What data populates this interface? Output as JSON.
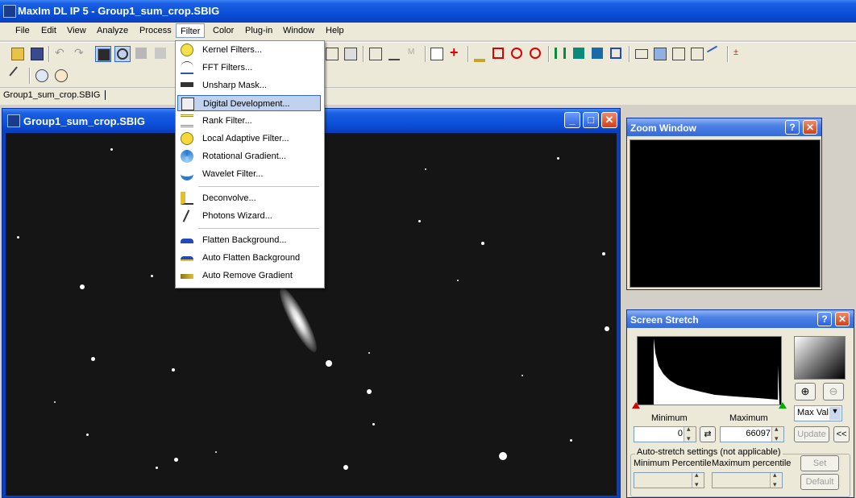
{
  "app": {
    "title": "MaxIm DL IP 5 - Group1_sum_crop.SBIG"
  },
  "menubar": {
    "items": [
      {
        "label": "File"
      },
      {
        "label": "Edit"
      },
      {
        "label": "View"
      },
      {
        "label": "Analyze"
      },
      {
        "label": "Process"
      },
      {
        "label": "Filter"
      },
      {
        "label": "Color"
      },
      {
        "label": "Plug-in"
      },
      {
        "label": "Window"
      },
      {
        "label": "Help"
      }
    ]
  },
  "filter_menu": {
    "items": [
      {
        "label": "Kernel Filters..."
      },
      {
        "label": "FFT Filters..."
      },
      {
        "label": "Unsharp Mask..."
      },
      {
        "label": "Digital Development..."
      },
      {
        "label": "Rank Filter..."
      },
      {
        "label": "Local Adaptive Filter..."
      },
      {
        "label": "Rotational Gradient..."
      },
      {
        "label": "Wavelet Filter..."
      },
      {
        "label": "Deconvolve..."
      },
      {
        "label": "Photons Wizard..."
      },
      {
        "label": "Flatten Background..."
      },
      {
        "label": "Auto Flatten Background"
      },
      {
        "label": "Auto Remove Gradient"
      }
    ],
    "highlighted": "Digital Development..."
  },
  "document_tab": {
    "label": "Group1_sum_crop.SBIG"
  },
  "image_window": {
    "title": "Group1_sum_crop.SBIG"
  },
  "zoom_window": {
    "title": "Zoom Window"
  },
  "screen_stretch": {
    "title": "Screen Stretch",
    "minimum_label": "Minimum",
    "maximum_label": "Maximum",
    "minimum_value": "0",
    "maximum_value": "66097",
    "mode_select": "Max Val",
    "update_button": "Update",
    "collapse_button": "<<",
    "auto_group": "Auto-stretch settings (not applicable)",
    "min_percentile_label": "Minimum Percentile",
    "max_percentile_label": "Maximum percentile",
    "set_button": "Set",
    "default_button": "Default"
  },
  "colors": {
    "titlebar": "#0a4fd8",
    "menu_highlight": "#c1d2ee",
    "panel_bg": "#ece9d8"
  }
}
